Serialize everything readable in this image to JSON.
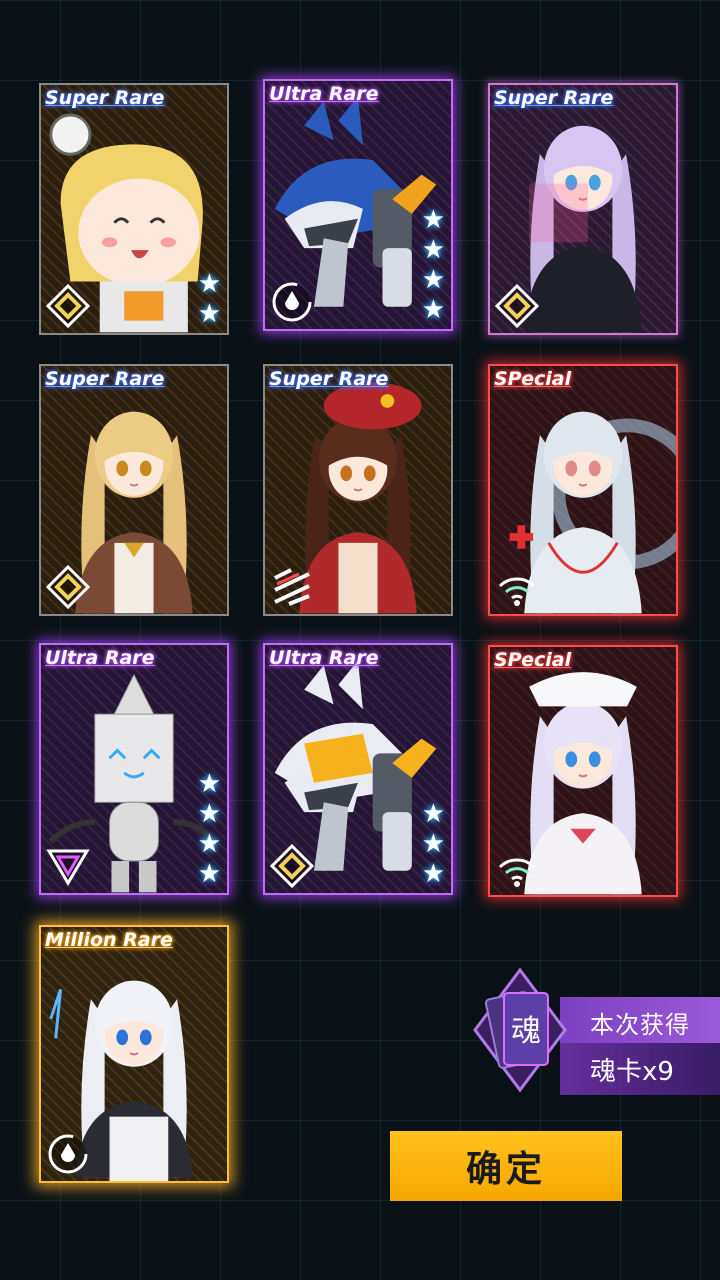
{
  "cards": [
    {
      "rarity": "Super Rare",
      "tier": "sr",
      "stars": 2,
      "badge": "diamond-icon",
      "art": "chibi-blonde-girl"
    },
    {
      "rarity": "Ultra Rare",
      "tier": "ur",
      "stars": 4,
      "badge": "drop-circle-icon",
      "art": "blue-mecha-beast"
    },
    {
      "rarity": "Super Rare",
      "tier": "sr-pink",
      "stars": 0,
      "badge": "diamond-icon",
      "art": "silver-haired-girl"
    },
    {
      "rarity": "Super Rare",
      "tier": "sr",
      "stars": 0,
      "badge": "diamond-icon",
      "art": "blonde-braided-girl"
    },
    {
      "rarity": "Super Rare",
      "tier": "sr",
      "stars": 0,
      "badge": "slash-icon",
      "art": "brunette-beret-girl"
    },
    {
      "rarity": "SPecial",
      "tier": "sp",
      "stars": 0,
      "badge": "wifi-icon",
      "art": "nurse-ghost-girl"
    },
    {
      "rarity": "Ultra Rare",
      "tier": "ur",
      "stars": 4,
      "badge": "triangle-icon",
      "art": "box-robot"
    },
    {
      "rarity": "Ultra Rare",
      "tier": "ur",
      "stars": 3,
      "badge": "diamond-icon",
      "art": "yellow-mecha-beast"
    },
    {
      "rarity": "SPecial",
      "tier": "sp",
      "stars": 0,
      "badge": "wifi-icon",
      "art": "nurse-girl"
    },
    {
      "rarity": "Million Rare",
      "tier": "mr",
      "stars": 0,
      "badge": "drop-circle-icon",
      "art": "white-haired-girl"
    }
  ],
  "reward": {
    "icon_char": "魂",
    "title": "本次获得",
    "count": "魂卡x9"
  },
  "confirm_label": "确定",
  "colors": {
    "ultra": "#c06cff",
    "special": "#ff4b4b",
    "million": "#ffbe3d",
    "button": "#ffb300",
    "reward_purple": "#7d3fc2"
  }
}
